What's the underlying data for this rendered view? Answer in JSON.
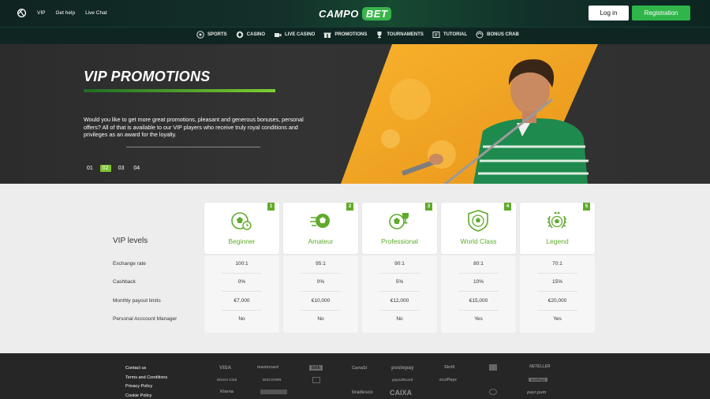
{
  "header": {
    "top_links": [
      "VIP",
      "Get help",
      "Live Chat"
    ],
    "logo": {
      "left": "CAMPO",
      "right": "BET"
    },
    "login_label": "Log in",
    "register_label": "Registration",
    "nav": [
      {
        "label": "SPORTS",
        "icon": "soccer-ball-icon"
      },
      {
        "label": "CASINO",
        "icon": "chip-icon"
      },
      {
        "label": "LIVE CASINO",
        "icon": "live-casino-icon"
      },
      {
        "label": "PROMOTIONS",
        "icon": "gift-icon"
      },
      {
        "label": "TOURNAMENTS",
        "icon": "trophy-icon"
      },
      {
        "label": "TUTORIAL",
        "icon": "tutorial-icon"
      },
      {
        "label": "BONUS CRAB",
        "icon": "bonus-crab-icon"
      }
    ]
  },
  "hero": {
    "title": "VIP PROMOTIONS",
    "text": "Would you like to get more great promotions, pleasant and generous bonuses, personal offers? All of that is available to our VIP players who receive truly royal conditions and privileges as an award for the loyalty.",
    "pager": [
      "01",
      "02",
      "03",
      "04"
    ],
    "active_page": "02"
  },
  "vip": {
    "title": "VIP levels",
    "row_labels": [
      "Exchange rate",
      "Cashback",
      "Monthly payout limits",
      "Personal Acccount Manager"
    ],
    "levels": [
      {
        "num": "1",
        "name": "Beginner",
        "icon": "soccer-ball-clock-icon",
        "values": [
          "100:1",
          "0%",
          "€7,000",
          "No"
        ]
      },
      {
        "num": "2",
        "name": "Amateur",
        "icon": "soccer-ball-flying-icon",
        "values": [
          "95:1",
          "0%",
          "€10,000",
          "No"
        ]
      },
      {
        "num": "3",
        "name": "Professional",
        "icon": "soccer-ball-trophy-icon",
        "values": [
          "90:1",
          "5%",
          "€12,000",
          "No"
        ]
      },
      {
        "num": "4",
        "name": "World Class",
        "icon": "soccer-ball-shield-icon",
        "values": [
          "80:1",
          "10%",
          "€15,000",
          "Yes"
        ]
      },
      {
        "num": "5",
        "name": "Legend",
        "icon": "soccer-ball-laurel-icon",
        "values": [
          "70:1",
          "15%",
          "€20,000",
          "Yes"
        ]
      }
    ]
  },
  "footer": {
    "links": [
      "Contact us",
      "Terms and Conditions",
      "Privacy Policy",
      "Cookie Policy"
    ],
    "payments": [
      "VISA",
      "mastercard",
      "blik",
      "CartaSi",
      "postepay",
      "Skrill",
      "ecoPayz",
      "NETELLER",
      "Diners Club",
      "DISCOVER",
      "paysafecard",
      "ecoPayz",
      "Klarna",
      "bradesco",
      "CAIXA",
      "payr.pum"
    ]
  },
  "colors": {
    "accent": "#5faa2b",
    "register": "#2fb54a",
    "hero_orange": "#f6a623"
  }
}
